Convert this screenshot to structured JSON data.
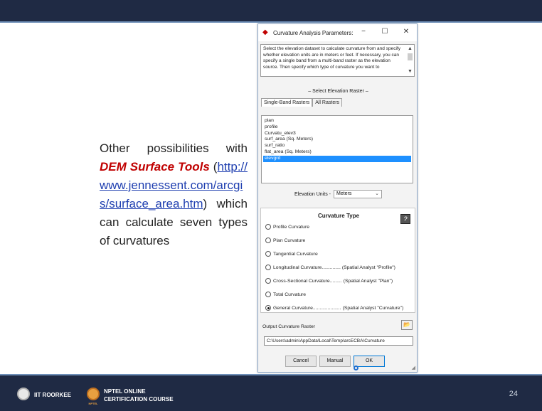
{
  "slide": {
    "text_before": "Other possibilities with ",
    "highlight": "DEM Surface Tools",
    "paren_open": " (",
    "link": "http://www.jennessent.com/arcgis/surface_area.htm",
    "text_after": ") which can calculate seven types of curvatures",
    "page_number": "24",
    "colors": {
      "header_bg": "#1f2a44",
      "highlight": "#c00000",
      "link": "#1f3fb0"
    }
  },
  "footer": {
    "institute": "IIT ROORKEE",
    "course_line1": "NPTEL ONLINE",
    "course_line2": "CERTIFICATION COURSE",
    "course_logo_text": "NPTEL"
  },
  "dialog": {
    "title": "Curvature Analysis Parameters:",
    "title_icon": "diamond-icon",
    "window_buttons": {
      "minimize": "−",
      "maximize": "☐",
      "close": "✕"
    },
    "description": "Select the elevation dataset to calculate curvature from and specify whether elevation units are in meters or feet. If necessary, you can specify a single band from a multi-band raster as the elevation source. Then specify which type of curvature you want to",
    "select_label": "– Select Elevation Raster –",
    "tabs": [
      {
        "label": "Single-Band Rasters",
        "active": true
      },
      {
        "label": "All Rasters",
        "active": false
      }
    ],
    "rasters": [
      "plan",
      "profile",
      "Curvatu_elev3",
      "surf_area (Sq. Meters)",
      "surf_ratio",
      "flat_area (Sq. Meters)",
      "elevgrd"
    ],
    "selected_raster": "elevgrd",
    "elevation_units_label": "Elevation Units -",
    "elevation_units_value": "Meters",
    "curvature_type_title": "Curvature Type",
    "curvature_options": [
      {
        "label": "Profile Curvature",
        "extra": "",
        "checked": false
      },
      {
        "label": "Plan Curvature",
        "extra": "",
        "checked": false
      },
      {
        "label": "Tangential Curvature",
        "extra": "",
        "checked": false
      },
      {
        "label": "Longitudinal Curvature..............",
        "extra": "(Spatial Analyst \"Profile\")",
        "checked": false
      },
      {
        "label": "Cross-Sectional Curvature.........",
        "extra": "(Spatial Analyst \"Plan\")",
        "checked": false
      },
      {
        "label": "Total Curvature",
        "extra": "",
        "checked": false
      },
      {
        "label": "General Curvature.....................",
        "extra": "(Spatial Analyst \"Curvature\")",
        "checked": true
      }
    ],
    "output_label": "Output Curvature Raster",
    "output_path": "C:\\Users\\admin\\AppData\\Local\\Temp\\arcECBA\\Curvature",
    "buttons": {
      "cancel": "Cancel",
      "manual": "Manual",
      "ok": "OK"
    },
    "help_glyph": "?"
  }
}
